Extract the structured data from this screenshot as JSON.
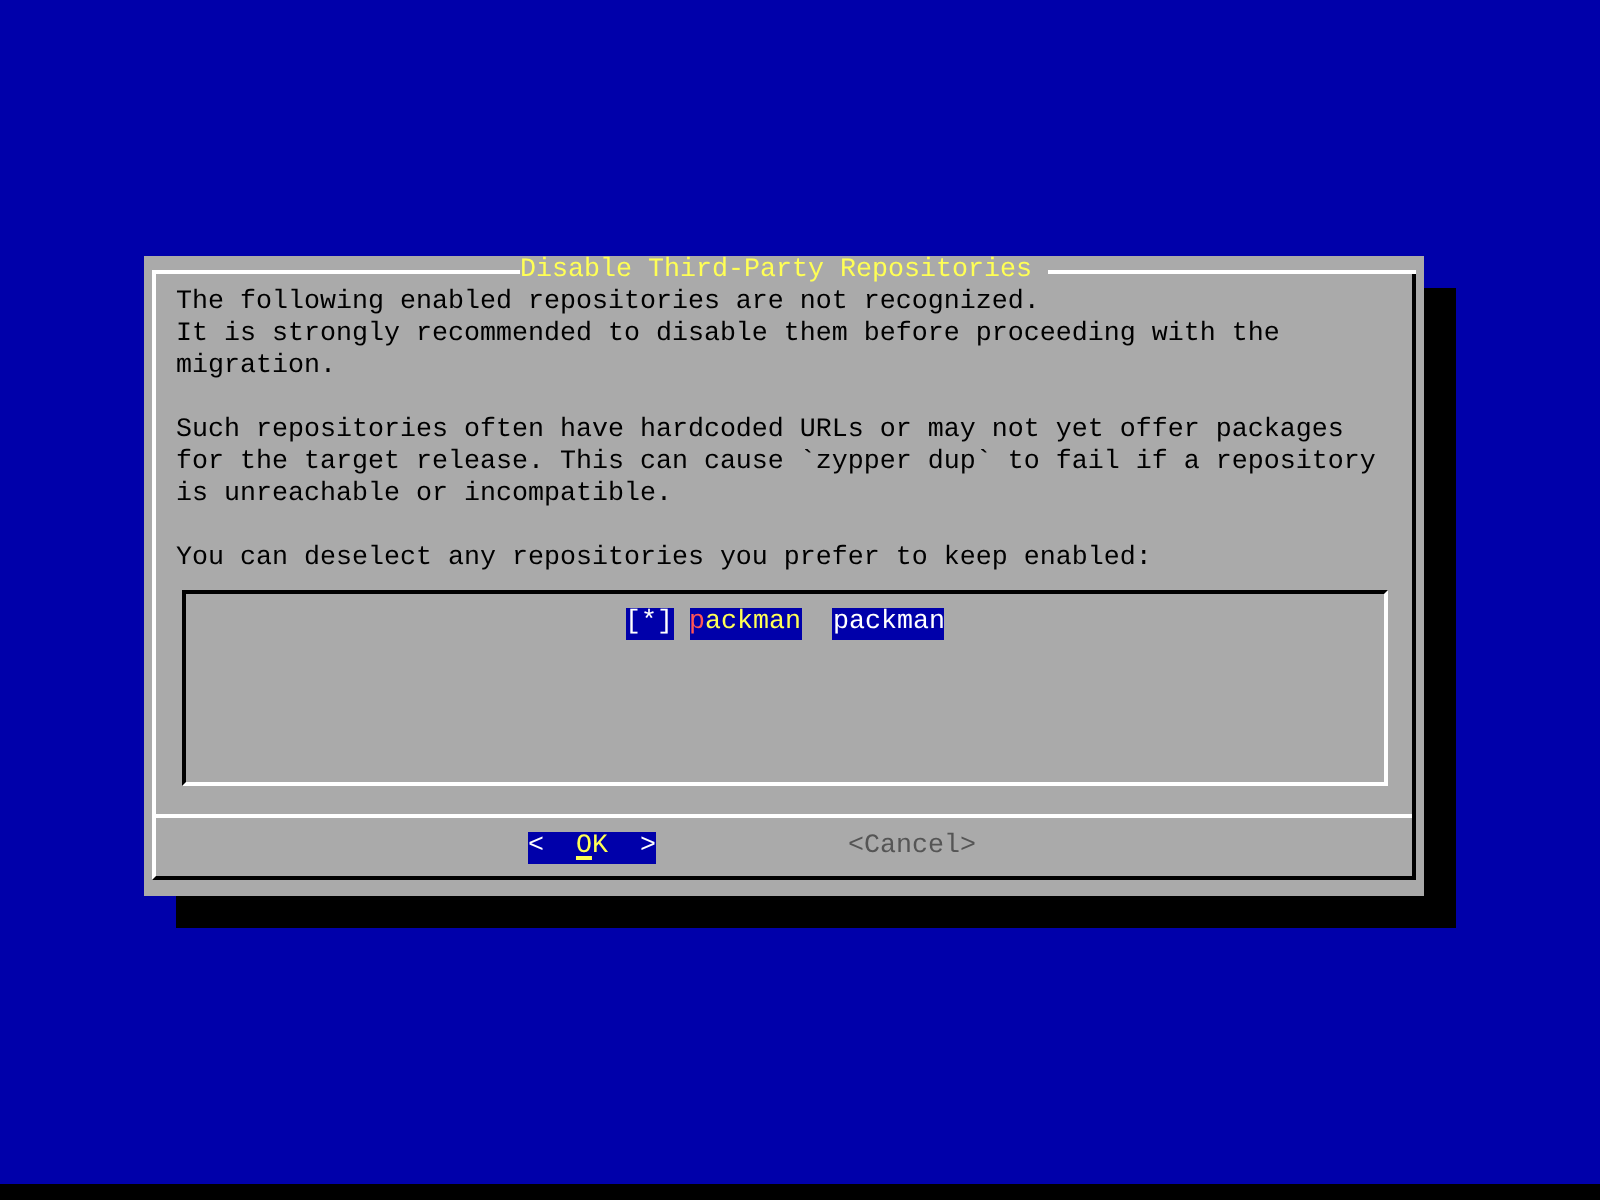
{
  "dialog": {
    "title": "Disable Third-Party Repositories",
    "paragraphs": [
      [
        "The following enabled repositories are not recognized.",
        "It is strongly recommended to disable them before proceeding with the migration."
      ],
      [
        "Such repositories often have hardcoded URLs or may not yet offer packages for the target release. This can cause `zypper dup` to fail if a repository is unreachable or incompatible."
      ]
    ],
    "prompt": "You can deselect any repositories you prefer to keep enabled:",
    "list": {
      "items": [
        {
          "checkbox": "[*]",
          "checked": true,
          "selected": true,
          "texts": [
            "packman",
            "packman"
          ]
        }
      ]
    },
    "buttons": [
      {
        "left": "<",
        "label": "OK",
        "right": ">",
        "selected": true
      },
      {
        "left": "<",
        "label": "Cancel",
        "right": ">",
        "selected": false
      }
    ]
  }
}
